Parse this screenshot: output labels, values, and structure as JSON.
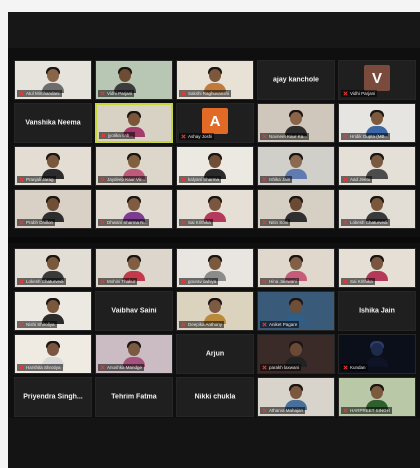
{
  "meeting": {
    "grid_top": [
      {
        "name": "Atul Mirchandani",
        "muted": true,
        "video": true,
        "skin": "#8a6648",
        "shirt": "#6d6d6d",
        "bg": "#e6e2dc"
      },
      {
        "name": "Vidhi Parjani",
        "muted": true,
        "video": true,
        "wide": true,
        "skin": "#6e4c33",
        "shirt": "#3c3c3c",
        "bg": "#b7c7b4"
      },
      {
        "name": "Sakshi Raghuvanshi",
        "muted": true,
        "video": true,
        "skin": "#7b573c",
        "shirt": "#c07a3b",
        "bg": "#e8e1d5"
      },
      {
        "name": "ajay kanchole",
        "muted": false,
        "video": false
      },
      {
        "name": "Vidhi Parjani",
        "muted": true,
        "video": false,
        "letter": "V",
        "letter_bg": "#7a4a3c"
      },
      {
        "name": "Vanshika Neema",
        "muted": false,
        "video": false
      },
      {
        "name": "jyotika sab...",
        "muted": true,
        "video": true,
        "active": true,
        "skin": "#7b553a",
        "shirt": "#a43b6a",
        "bg": "#d8d2c4"
      },
      {
        "name": "Ashay Joshi",
        "muted": true,
        "video": false,
        "letter": "A",
        "letter_bg": "#e16b26"
      },
      {
        "name": "Navneet Kaur Ka...",
        "muted": true,
        "video": true,
        "skin": "#8a6448",
        "shirt": "#2e2e2e",
        "bg": "#cfc7bb"
      },
      {
        "name": "Hridik Gupta (MB...",
        "muted": true,
        "video": true,
        "skin": "#7d5a3e",
        "shirt": "#3b67a5",
        "bg": "#e7e5e2"
      },
      {
        "name": "Pranjali Jarag",
        "muted": true,
        "video": true,
        "skin": "#7a583e",
        "shirt": "#2b2b2b",
        "bg": "#e3ddd3"
      },
      {
        "name": "Jaydeep Kaur Vir...",
        "muted": true,
        "video": true,
        "skin": "#80603f",
        "shirt": "#c05a7a",
        "bg": "#ddd6cb"
      },
      {
        "name": "kalyani Sharma",
        "muted": true,
        "video": true,
        "skin": "#6f4f38",
        "shirt": "#2a2a2a",
        "bg": "#ece8e2"
      },
      {
        "name": "Ishika Jain",
        "muted": true,
        "video": true,
        "skin": "#8a6a50",
        "shirt": "#5f7bb1",
        "bg": "#d1cfc9"
      },
      {
        "name": "Aad Jeetu",
        "muted": true,
        "video": true,
        "skin": "#7a5a40",
        "shirt": "#4c4c4c",
        "bg": "#e4e0d8"
      },
      {
        "name": "Prabh Dhillon",
        "muted": true,
        "video": true,
        "skin": "#6f4f36",
        "shirt": "#2d2d2d",
        "bg": "#d9d1c6"
      },
      {
        "name": "Dhwani Sharma N...",
        "muted": true,
        "video": true,
        "skin": "#7e5b41",
        "shirt": "#7a3d8f",
        "bg": "#e0dad1"
      },
      {
        "name": "Sai Krithika",
        "muted": true,
        "video": true,
        "skin": "#7a5640",
        "shirt": "#b5395a",
        "bg": "#e5dfd6"
      },
      {
        "name": "Nitin Soni",
        "muted": true,
        "video": true,
        "skin": "#6b4a35",
        "shirt": "#2f2f2f",
        "bg": "#d6d0c4"
      },
      {
        "name": "Lokesh Chaturvedi",
        "muted": true,
        "video": true,
        "skin": "#7a583c",
        "shirt": "#3a3a3a",
        "bg": "#e2ddd5"
      }
    ],
    "grid_bottom": [
      {
        "name": "Lokesh Chaturvedi",
        "muted": true,
        "video": true,
        "skin": "#7a583c",
        "shirt": "#3a3a3a",
        "bg": "#e2ddd5"
      },
      {
        "name": "Mohini Thakur",
        "muted": true,
        "video": true,
        "skin": "#815d43",
        "shirt": "#c23a4b",
        "bg": "#dcd6cc"
      },
      {
        "name": "gourav dahiya",
        "muted": true,
        "video": true,
        "skin": "#7a593f",
        "shirt": "#8b8b8b",
        "bg": "#e9e6e1"
      },
      {
        "name": "Hina Jaiswani",
        "muted": true,
        "video": true,
        "skin": "#806047",
        "shirt": "#c55c7a",
        "bg": "#e0d8cd"
      },
      {
        "name": "Sai Krithika",
        "muted": true,
        "video": true,
        "skin": "#7a5640",
        "shirt": "#b5395a",
        "bg": "#e5dfd6"
      },
      {
        "name": "Nishi Shiroliya",
        "muted": true,
        "video": true,
        "skin": "#7a583e",
        "shirt": "#2b2b2b",
        "bg": "#ece8e2"
      },
      {
        "name": "Vaibhav Saini",
        "muted": false,
        "video": false
      },
      {
        "name": "Deepika Anthony",
        "muted": true,
        "video": true,
        "skin": "#7d5b42",
        "shirt": "#b88a3a",
        "bg": "#dcd3bf"
      },
      {
        "name": "Aniket Pagare",
        "muted": true,
        "video": true,
        "skin": "#6e4e36",
        "shirt": "#2f5f86",
        "bg": "#3a5a7a"
      },
      {
        "name": "Ishika Jain",
        "muted": false,
        "video": false
      },
      {
        "name": "Harshita Shrotiya",
        "muted": true,
        "video": true,
        "skin": "#7a5640",
        "shirt": "#d9d9d9",
        "bg": "#efeae2"
      },
      {
        "name": "Anushka Mandge",
        "muted": true,
        "video": true,
        "skin": "#7b5a42",
        "shirt": "#a4547c",
        "bg": "#cbbcc4"
      },
      {
        "name": "Arjun",
        "muted": false,
        "video": false
      },
      {
        "name": "parakh laxwani",
        "muted": true,
        "video": true,
        "skin": "#6a4a35",
        "shirt": "#222222",
        "bg": "#3a2a28"
      },
      {
        "name": "Kundan",
        "muted": true,
        "video": true,
        "dark": true,
        "skin": "#1d2a4a",
        "shirt": "#0e1426",
        "bg": "#0b0f1a"
      },
      {
        "name": "Priyendra Singh...",
        "muted": false,
        "video": false
      },
      {
        "name": "Tehrim Fatma",
        "muted": false,
        "video": false
      },
      {
        "name": "Nikki chukla",
        "muted": false,
        "video": false
      },
      {
        "name": "Atharva Mahajan",
        "muted": true,
        "video": true,
        "skin": "#7a583e",
        "shirt": "#4a6f9a",
        "bg": "#d8d3cb"
      },
      {
        "name": "HARPREET SINGH",
        "muted": true,
        "video": true,
        "skin": "#7c5a3e",
        "shirt": "#2f5f2f",
        "bg": "#b9c9a8"
      }
    ]
  }
}
